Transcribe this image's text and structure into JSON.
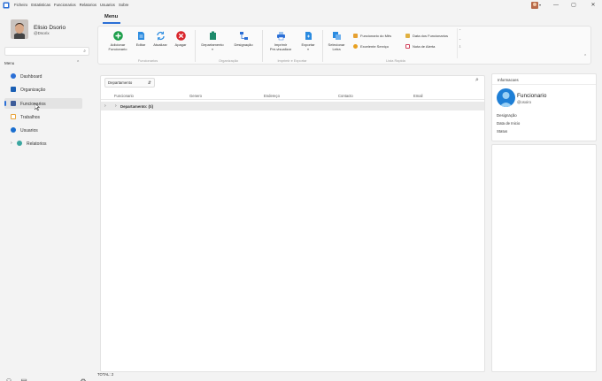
{
  "menubar": [
    "Ficheiro",
    "Estatisticas",
    "Funcionarios",
    "Relatorios",
    "Usuarios",
    "Sobre"
  ],
  "window_controls": {
    "minimize": "—",
    "maximize": "▢",
    "close": "✕"
  },
  "user": {
    "name": "Elisio Dsorio",
    "handle": "@Dsorix"
  },
  "sidebar": {
    "menu_title": "Menu",
    "items": [
      {
        "label": "Dashboard",
        "icon": "dashboard-icon",
        "color": "#2b6fd6"
      },
      {
        "label": "Organização",
        "icon": "organization-icon",
        "color": "#1a5fb4"
      },
      {
        "label": "Funcionarios",
        "icon": "employees-icon",
        "color": "#3d5c99",
        "active": true
      },
      {
        "label": "Trabalhos",
        "icon": "jobs-icon",
        "color": "#e8a33a"
      },
      {
        "label": "Usuarios",
        "icon": "users-icon",
        "color": "#1a6ecf"
      },
      {
        "label": "Relatorios",
        "icon": "reports-icon",
        "color": "#3aa6a0"
      }
    ]
  },
  "ribbon": {
    "tab": "Menu",
    "buttons": {
      "adicionar": "Adicionar\nFuncionario",
      "editar": "Editar",
      "atualizar": "Atualizar",
      "apagar": "Apagar",
      "departamento": "Departamento",
      "designacao": "Designação",
      "imprimir": "Imprimir\nPre-visualizar",
      "exportar": "Exportar",
      "selecionar_letra": "Selecionar\nLetra"
    },
    "groups": {
      "funcionarios": "Funcionarios",
      "organizacao": "Organização",
      "imprimir_exportar": "Imprimir e Exportar",
      "lista_rapida": "Lista Rapida"
    },
    "quick_list": [
      {
        "label": "Funcionario do Mês",
        "color": "#e6a030"
      },
      {
        "label": "Data dos Funcionarios",
        "color": "#e0b040"
      },
      {
        "label": "Excelente Serviço",
        "color": "#e8a020"
      },
      {
        "label": "Nota de Alerta",
        "color": "#d0405a"
      }
    ]
  },
  "grid": {
    "group_by": "Departamento",
    "columns": [
      "Funcionario",
      "Genero",
      "Endereço",
      "Contacto",
      "Email"
    ],
    "group_row": "Departamento: (ti)"
  },
  "info": {
    "title": "Informacoes",
    "name": "Funcionario",
    "handle": "@osoiro",
    "fields": [
      "Designação",
      "Data de Inicio",
      "Status"
    ]
  },
  "status": {
    "total": "TOTAL: 2"
  },
  "colors": {
    "accent": "#2b6fd6",
    "add": "#1c9e4a",
    "delete": "#d9262c"
  }
}
